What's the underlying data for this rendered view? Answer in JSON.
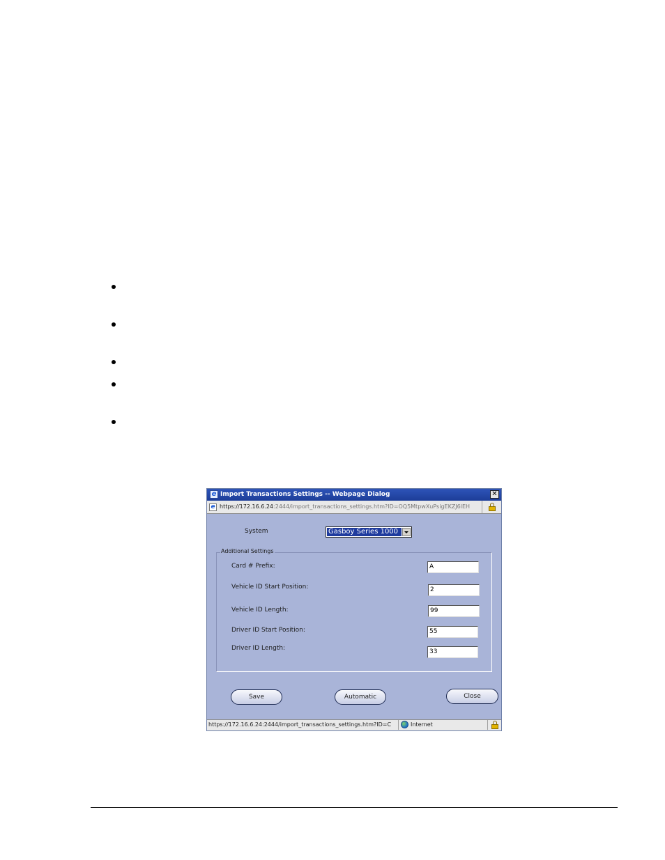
{
  "dialog": {
    "title": "Import Transactions Settings -- Webpage Dialog",
    "address": {
      "host": "https://172.16.6.24",
      "rest": ":2444/import_transactions_settings.htm?ID=OQ5MtpwXuPsigEKZJ6lEH"
    },
    "system_label": "System",
    "system_value": "Gasboy Series 1000",
    "additional_settings_legend": "Additional Settings",
    "fields": [
      {
        "label": "Card # Prefix:",
        "value": "A"
      },
      {
        "label": "Vehicle ID Start Position:",
        "value": "2"
      },
      {
        "label": "Vehicle ID Length:",
        "value": "99"
      },
      {
        "label": "Driver ID Start Position:",
        "value": "55"
      },
      {
        "label": "Driver ID Length:",
        "value": "33"
      }
    ],
    "buttons": {
      "save": "Save",
      "automatic": "Automatic",
      "close": "Close"
    },
    "status": {
      "url": "https://172.16.6.24:2444/import_transactions_settings.htm?ID=C",
      "zone": "Internet"
    }
  }
}
